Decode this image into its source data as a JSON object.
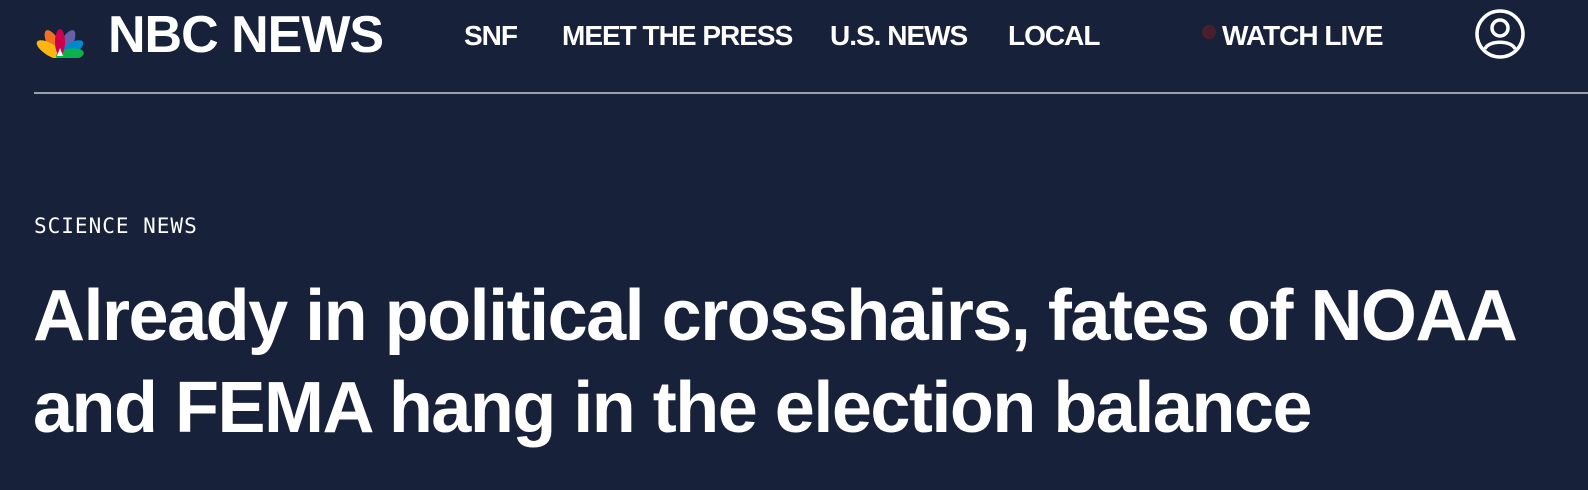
{
  "logo": {
    "wordmark": "NBC NEWS",
    "icon": "nbc-peacock-icon",
    "colors": [
      "#fcb711",
      "#f37021",
      "#cc004c",
      "#6460aa",
      "#0089d0",
      "#0db14b"
    ]
  },
  "nav": {
    "items": [
      {
        "label": "SNF"
      },
      {
        "label": "MEET THE PRESS"
      },
      {
        "label": "U.S. NEWS"
      },
      {
        "label": "LOCAL"
      }
    ],
    "watch_live": "WATCH LIVE",
    "account_icon": "user-account-icon"
  },
  "article": {
    "section": "SCIENCE NEWS",
    "headline": "Already in political crosshairs, fates of NOAA and FEMA hang in the election balance"
  },
  "theme": {
    "background": "#17213a",
    "text": "#ffffff",
    "divider": "#9aa0ad",
    "live_dot": "#4a1f2c"
  }
}
